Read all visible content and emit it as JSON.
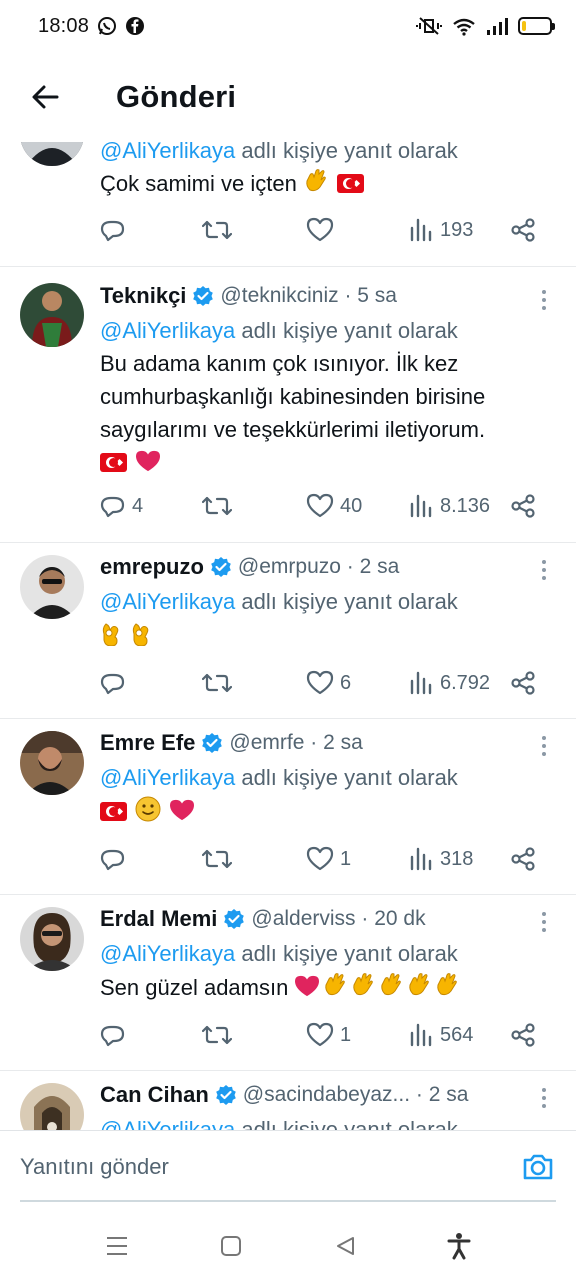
{
  "status_bar": {
    "time": "18:08",
    "battery_level": 0.15
  },
  "header": {
    "title": "Gönderi"
  },
  "reply_prefix": "adlı kişiye yanıt olarak",
  "reply_mention": "@AliYerlikaya",
  "tweets": [
    {
      "name": "",
      "handle": "",
      "age": "",
      "text": "Çok samimi ve içten",
      "emojis": [
        "clap",
        "tr-flag"
      ],
      "replies": "",
      "retweets": "",
      "likes": "",
      "views": "193"
    },
    {
      "name": "Teknikçi",
      "handle": "@teknikciniz",
      "age": "5 sa",
      "text": "Bu adama kanım çok ısınıyor. İlk kez cumhurbaşkanlığı kabinesinden birisine saygılarımı ve teşekkürlerimi iletiyorum.",
      "emojis": [
        "tr-flag",
        "red-heart"
      ],
      "replies": "4",
      "retweets": "",
      "likes": "40",
      "views": "8.136"
    },
    {
      "name": "emrepuzo",
      "handle": "@emrpuzo",
      "age": "2 sa",
      "text": "",
      "emojis": [
        "ok-hand",
        "ok-hand"
      ],
      "replies": "",
      "retweets": "",
      "likes": "6",
      "views": "6.792"
    },
    {
      "name": "Emre Efe",
      "handle": "@emrfe",
      "age": "2 sa",
      "text": "",
      "emojis": [
        "tr-flag",
        "slightly-smiling-face",
        "red-heart"
      ],
      "replies": "",
      "retweets": "",
      "likes": "1",
      "views": "318"
    },
    {
      "name": "Erdal Memi",
      "handle": "@alderviss",
      "age": "20 dk",
      "text": "Sen güzel adamsın",
      "emojis": [
        "red-heart",
        "clap",
        "clap",
        "clap",
        "clap",
        "clap"
      ],
      "replies": "",
      "retweets": "",
      "likes": "1",
      "views": "564"
    },
    {
      "name": "Can Cihan",
      "handle": "@sacindabeyaz...",
      "age": "2 sa",
      "text": "",
      "emojis": [],
      "replies": "",
      "retweets": "",
      "likes": "",
      "views": ""
    }
  ],
  "reply_bar": {
    "placeholder": "Yanıtını gönder"
  },
  "colors": {
    "accent": "#1d9bf0",
    "muted": "#536471",
    "text": "#0f1419",
    "like_red": "#e0245e"
  }
}
